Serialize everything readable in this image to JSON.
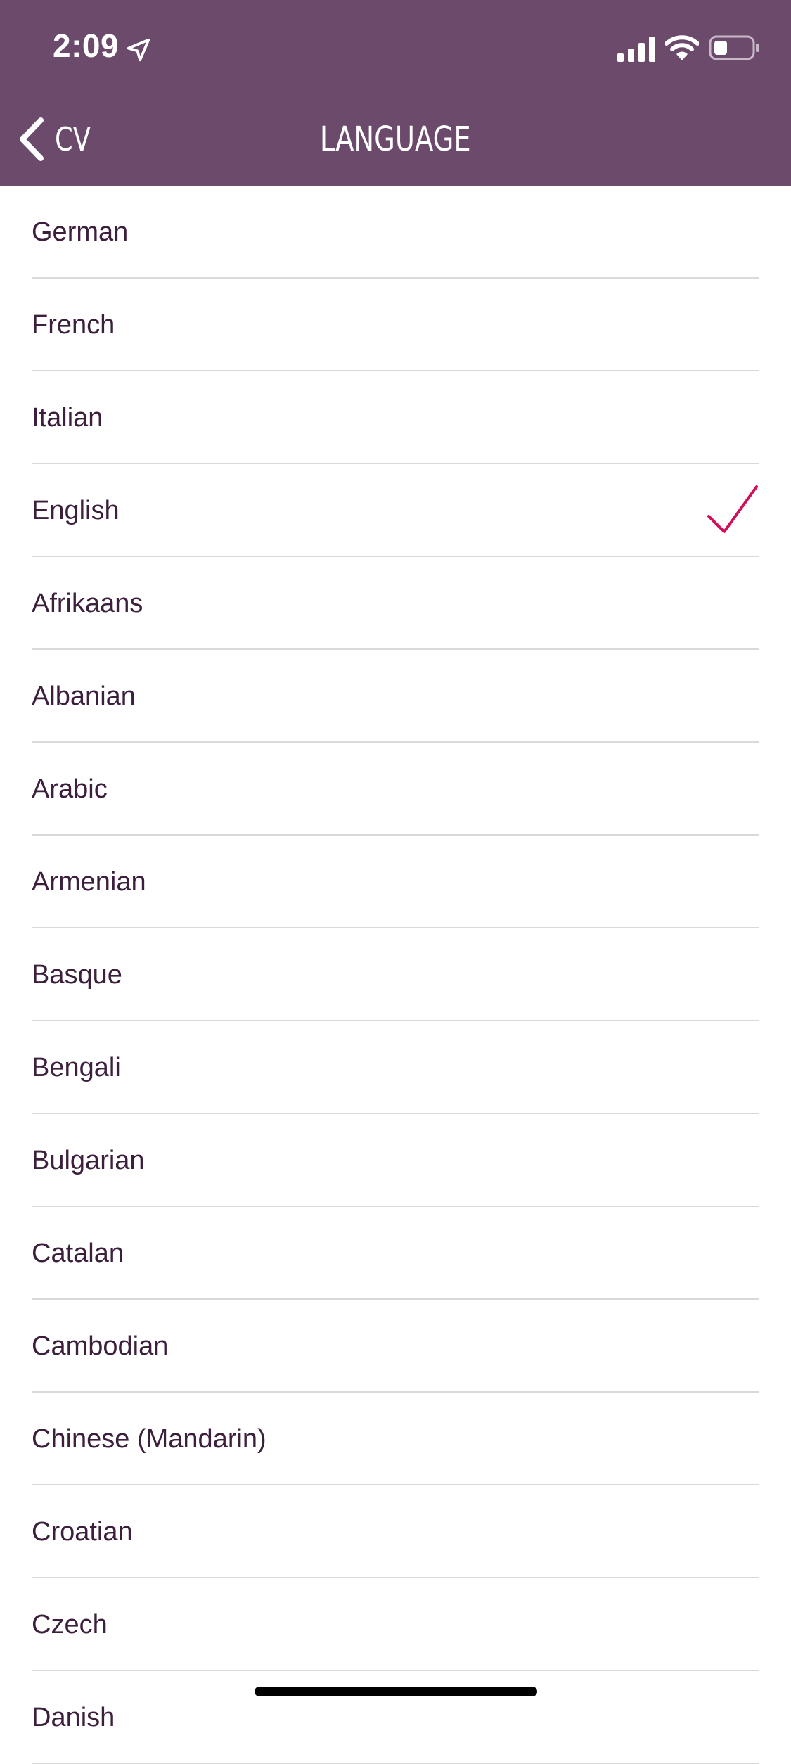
{
  "status_bar": {
    "time": "2:09"
  },
  "nav": {
    "back_label": "CV",
    "title": "LANGUAGE"
  },
  "colors": {
    "header": "#6b4a6b",
    "text": "#3c1f3c",
    "check": "#d0105a"
  },
  "languages": [
    {
      "label": "German",
      "selected": false
    },
    {
      "label": "French",
      "selected": false
    },
    {
      "label": "Italian",
      "selected": false
    },
    {
      "label": "English",
      "selected": true
    },
    {
      "label": "Afrikaans",
      "selected": false
    },
    {
      "label": "Albanian",
      "selected": false
    },
    {
      "label": "Arabic",
      "selected": false
    },
    {
      "label": "Armenian",
      "selected": false
    },
    {
      "label": "Basque",
      "selected": false
    },
    {
      "label": "Bengali",
      "selected": false
    },
    {
      "label": "Bulgarian",
      "selected": false
    },
    {
      "label": "Catalan",
      "selected": false
    },
    {
      "label": "Cambodian",
      "selected": false
    },
    {
      "label": "Chinese (Mandarin)",
      "selected": false
    },
    {
      "label": "Croatian",
      "selected": false
    },
    {
      "label": "Czech",
      "selected": false
    },
    {
      "label": "Danish",
      "selected": false
    }
  ]
}
